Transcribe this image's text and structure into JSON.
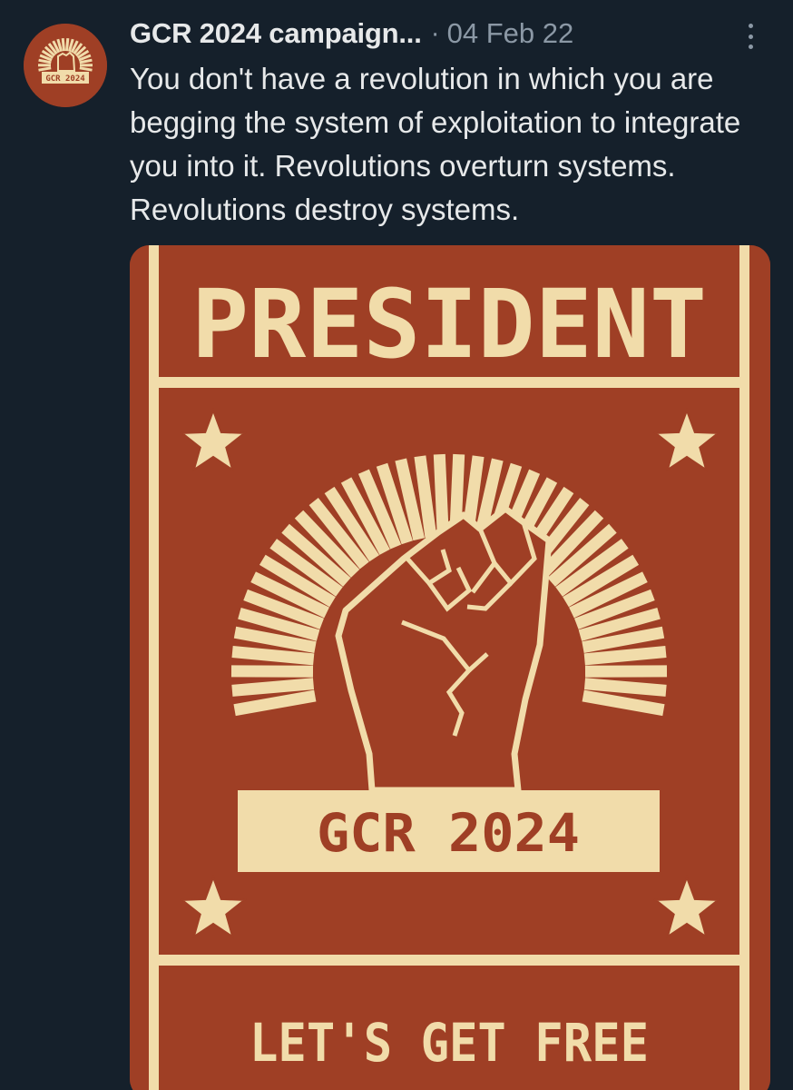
{
  "tweet": {
    "author_name": "GCR 2024 campaign...",
    "separator": "·",
    "date": "04 Feb 22",
    "text": "You don't have a revolution in which you are begging the system of exploitation to integrate you into it. Revolutions overturn systems. Revolutions destroy systems."
  },
  "avatar": {
    "logo_text": "GCR 2024"
  },
  "media": {
    "top_text": "PRESIDENT",
    "banner_text": "GCR 2024",
    "bottom_text": "LET'S GET FREE"
  },
  "icons": {
    "more": "more-vertical-icon",
    "star": "star-icon",
    "fist": "raised-fist-icon",
    "rays": "sunburst-rays-icon"
  },
  "colors": {
    "background": "#15202b",
    "text_primary": "#e7e9ea",
    "text_secondary": "#8b98a5",
    "poster_red": "#9f3f25",
    "poster_cream": "#f1dcaa"
  }
}
